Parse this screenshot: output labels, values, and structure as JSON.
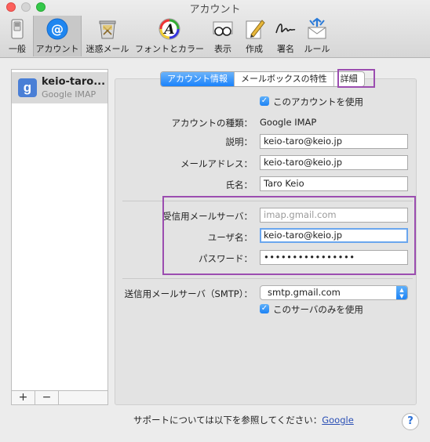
{
  "window": {
    "title": "アカウント"
  },
  "toolbar": {
    "items": [
      {
        "label": "一般",
        "icon": "general-switch-icon"
      },
      {
        "label": "アカウント",
        "icon": "at-sign-icon"
      },
      {
        "label": "迷惑メール",
        "icon": "junk-trash-icon"
      },
      {
        "label": "フォントとカラー",
        "icon": "font-color-icon"
      },
      {
        "label": "表示",
        "icon": "glasses-icon"
      },
      {
        "label": "作成",
        "icon": "compose-pencil-icon"
      },
      {
        "label": "署名",
        "icon": "signature-icon"
      },
      {
        "label": "ルール",
        "icon": "rules-envelope-icon"
      }
    ]
  },
  "sidebar": {
    "accounts": [
      {
        "name": "keio-taro...",
        "type": "Google IMAP",
        "badge": "g"
      }
    ],
    "add_label": "+",
    "remove_label": "−"
  },
  "tabs": [
    {
      "label": "アカウント情報",
      "selected": true
    },
    {
      "label": "メールボックスの特性",
      "selected": false
    },
    {
      "label": "詳細",
      "selected": false
    }
  ],
  "form": {
    "enable_account": {
      "label": "このアカウントを使用",
      "checked": true
    },
    "account_type": {
      "label": "アカウントの種類：",
      "value": "Google IMAP"
    },
    "description": {
      "label": "説明：",
      "value": "keio-taro@keio.jp"
    },
    "email": {
      "label": "メールアドレス：",
      "value": "keio-taro@keio.jp"
    },
    "full_name": {
      "label": "氏名：",
      "value": "Taro Keio"
    },
    "incoming_server": {
      "label": "受信用メールサーバ：",
      "value": "imap.gmail.com"
    },
    "username": {
      "label": "ユーザ名：",
      "value": "keio-taro@keio.jp"
    },
    "password": {
      "label": "パスワード：",
      "value": "••••••••••••••••"
    },
    "smtp": {
      "label": "送信用メールサーバ（SMTP）：",
      "value": "smtp.gmail.com"
    },
    "only_this_server": {
      "label": "このサーバのみを使用",
      "checked": true
    }
  },
  "support": {
    "text": "サポートについては以下を参照してください：",
    "link": "Google"
  },
  "help_label": "?",
  "colors": {
    "accent": "#1a82fb",
    "highlight": "#9b4db0"
  }
}
